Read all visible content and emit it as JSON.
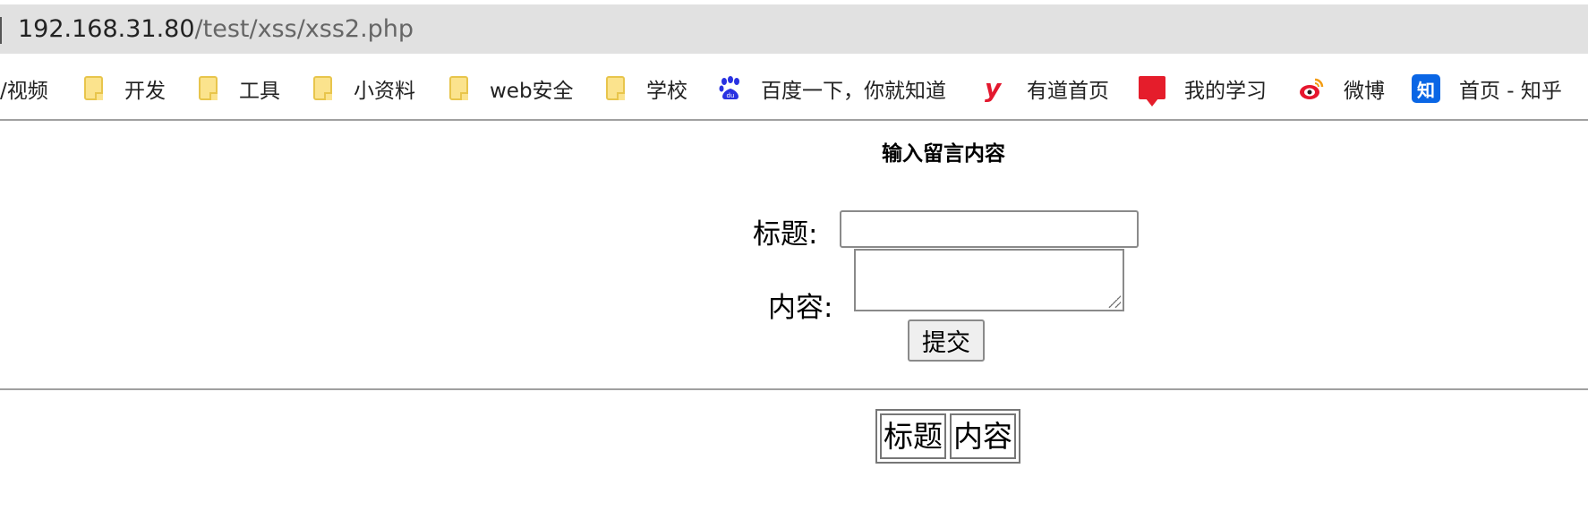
{
  "browser": {
    "url_host": "192.168.31.80",
    "url_path": "/test/xss/xss2.php"
  },
  "bookmarks": [
    {
      "label": "/视频",
      "icon": "none"
    },
    {
      "label": "开发",
      "icon": "folder-icon"
    },
    {
      "label": "工具",
      "icon": "folder-icon"
    },
    {
      "label": "小资料",
      "icon": "folder-icon"
    },
    {
      "label": "web安全",
      "icon": "folder-icon"
    },
    {
      "label": "学校",
      "icon": "folder-icon"
    },
    {
      "label": "百度一下，你就知道",
      "icon": "baidu-paw-icon"
    },
    {
      "label": "有道首页",
      "icon": "youdao-icon"
    },
    {
      "label": "我的学习",
      "icon": "red-book-icon"
    },
    {
      "label": "微博",
      "icon": "weibo-icon"
    },
    {
      "label": "首页 - 知乎",
      "icon": "zhihu-icon",
      "icon_text": "知"
    }
  ],
  "form": {
    "heading": "输入留言内容",
    "title_label": "标题:",
    "content_label": "内容:",
    "submit_label": "提交"
  },
  "table": {
    "headers": [
      "标题",
      "内容"
    ]
  },
  "colors": {
    "folder": "#fbe38d",
    "zhihu": "#0a66e5",
    "youdao": "#e3182e",
    "baidu": "#2932e1",
    "weibo": "#e6162d"
  }
}
